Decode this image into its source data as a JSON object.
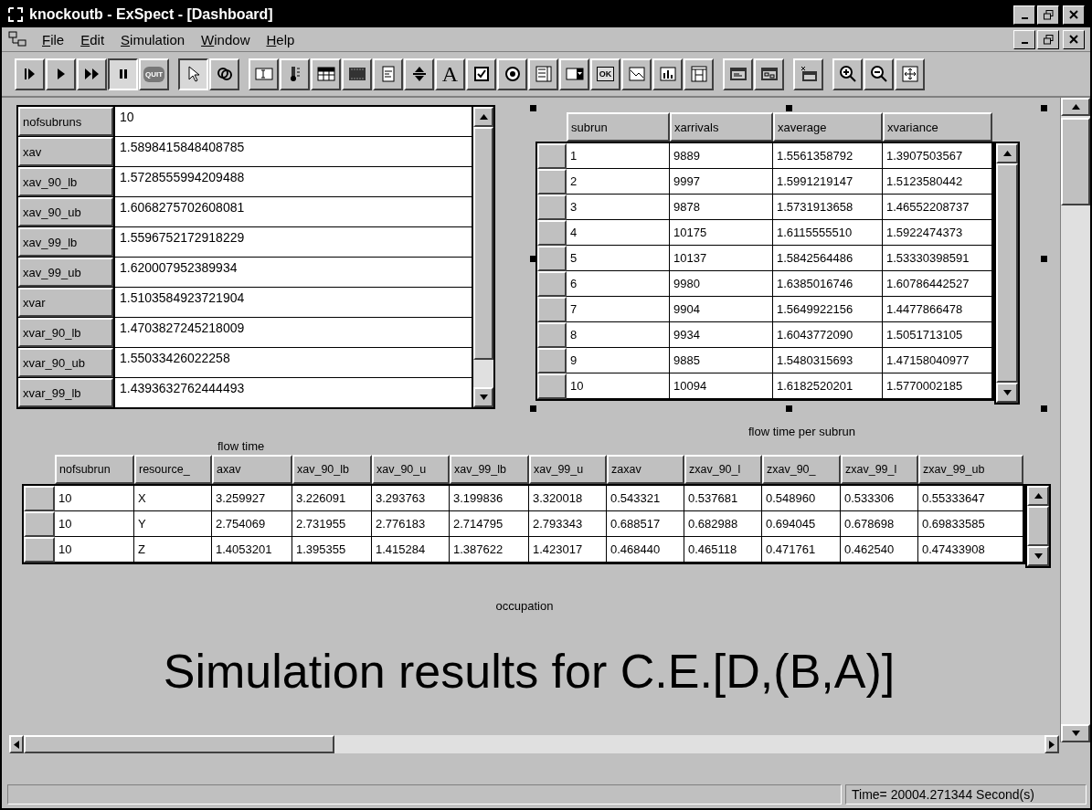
{
  "window": {
    "title": "knockoutb - ExSpect - [Dashboard]"
  },
  "menu": [
    "File",
    "Edit",
    "Simulation",
    "Window",
    "Help"
  ],
  "toolbar": [
    [
      {
        "kind": "step",
        "pressed": false
      },
      {
        "kind": "play",
        "pressed": false
      },
      {
        "kind": "fast",
        "pressed": false
      },
      {
        "kind": "pause",
        "pressed": true
      },
      {
        "kind": "quit",
        "pressed": false,
        "label": "QUIT"
      }
    ],
    [
      {
        "kind": "pointer",
        "pressed": true
      },
      {
        "kind": "rings",
        "pressed": false
      }
    ],
    [
      {
        "kind": "textfield",
        "pressed": false
      },
      {
        "kind": "thermometer",
        "pressed": false
      },
      {
        "kind": "table",
        "pressed": false
      },
      {
        "kind": "film",
        "pressed": false
      },
      {
        "kind": "form",
        "pressed": false
      },
      {
        "kind": "spinner",
        "pressed": false
      },
      {
        "kind": "letter",
        "pressed": false,
        "label": "A"
      },
      {
        "kind": "checkbox",
        "pressed": false
      },
      {
        "kind": "radio",
        "pressed": false
      },
      {
        "kind": "listbox",
        "pressed": false
      },
      {
        "kind": "dropdown",
        "pressed": false
      },
      {
        "kind": "ok",
        "pressed": false,
        "label": "OK"
      },
      {
        "kind": "graph",
        "pressed": false
      },
      {
        "kind": "bars",
        "pressed": false
      },
      {
        "kind": "grid",
        "pressed": false
      }
    ],
    [
      {
        "kind": "window",
        "pressed": false
      },
      {
        "kind": "linked",
        "pressed": false
      }
    ],
    [
      {
        "kind": "spark",
        "pressed": false
      }
    ],
    [
      {
        "kind": "zoomin",
        "pressed": false
      },
      {
        "kind": "zoomout",
        "pressed": false
      },
      {
        "kind": "fit",
        "pressed": false
      }
    ]
  ],
  "parameters": [
    {
      "label": "nofsubruns",
      "value": "10"
    },
    {
      "label": "xav",
      "value": "1.5898415848408785"
    },
    {
      "label": "xav_90_lb",
      "value": "1.5728555994209488"
    },
    {
      "label": "xav_90_ub",
      "value": "1.6068275702608081"
    },
    {
      "label": "xav_99_lb",
      "value": "1.5596752172918229"
    },
    {
      "label": "xav_99_ub",
      "value": "1.620007952389934"
    },
    {
      "label": "xvar",
      "value": "1.5103584923721904"
    },
    {
      "label": "xvar_90_lb",
      "value": "1.4703827245218009"
    },
    {
      "label": "xvar_90_ub",
      "value": "1.55033426022258"
    },
    {
      "label": "xvar_99_lb",
      "value": "1.4393632762444493"
    }
  ],
  "subrun_table": {
    "caption": "flow time per subrun",
    "columns": [
      "subrun",
      "xarrivals",
      "xaverage",
      "xvariance"
    ],
    "rows": [
      [
        "1",
        "9889",
        "1.5561358792",
        "1.3907503567"
      ],
      [
        "2",
        "9997",
        "1.5991219147",
        "1.5123580442"
      ],
      [
        "3",
        "9878",
        "1.5731913658",
        "1.46552208737"
      ],
      [
        "4",
        "10175",
        "1.6115555510",
        "1.5922474373"
      ],
      [
        "5",
        "10137",
        "1.5842564486",
        "1.53330398591"
      ],
      [
        "6",
        "9980",
        "1.6385016746",
        "1.60786442527"
      ],
      [
        "7",
        "9904",
        "1.5649922156",
        "1.4477866478"
      ],
      [
        "8",
        "9934",
        "1.6043772090",
        "1.5051713105"
      ],
      [
        "9",
        "9885",
        "1.5480315693",
        "1.47158040977"
      ],
      [
        "10",
        "10094",
        "1.6182520201",
        "1.5770002185"
      ]
    ]
  },
  "flow_caption": "flow time",
  "resource_table": {
    "caption": "occupation",
    "columns": [
      "nofsubrun",
      "resource_",
      "axav",
      "xav_90_lb",
      "xav_90_u",
      "xav_99_lb",
      "xav_99_u",
      "zaxav",
      "zxav_90_l",
      "zxav_90_",
      "zxav_99_l",
      "zxav_99_ub"
    ],
    "rows": [
      [
        "10",
        "X",
        "3.259927",
        "3.226091",
        "3.293763",
        "3.199836",
        "3.320018",
        "0.543321",
        "0.537681",
        "0.548960",
        "0.533306",
        "0.55333647"
      ],
      [
        "10",
        "Y",
        "2.754069",
        "2.731955",
        "2.776183",
        "2.714795",
        "2.793343",
        "0.688517",
        "0.682988",
        "0.694045",
        "0.678698",
        "0.69833585"
      ],
      [
        "10",
        "Z",
        "1.4053201",
        "1.395355",
        "1.415284",
        "1.387622",
        "1.423017",
        "0.468440",
        "0.465118",
        "0.471761",
        "0.462540",
        "0.47433908"
      ]
    ]
  },
  "headline": "Simulation results for C.E.[D,(B,A)]",
  "status_bar": {
    "time": "Time= 20004.271344 Second(s)"
  }
}
